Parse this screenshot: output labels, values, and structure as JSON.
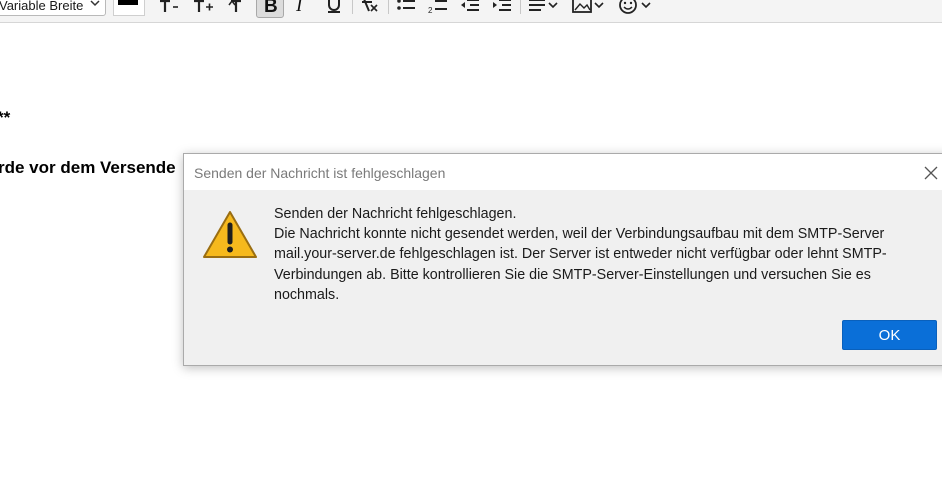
{
  "toolbar": {
    "font_select_value": "Variable Breite",
    "text_color": "#000000",
    "buttons": [
      "decrease-font-size",
      "increase-font-size",
      "bold",
      "italic",
      "underline",
      "clear-formatting",
      "bulleted-list",
      "numbered-list",
      "decrease-indent",
      "increase-indent",
      "align",
      "insert-image",
      "insert-emoji"
    ]
  },
  "message_body": {
    "line1": "**",
    "line2": "rde vor dem Versende"
  },
  "dialog": {
    "title": "Senden der Nachricht ist fehlgeschlagen",
    "icon": "warning-icon",
    "message_lines": [
      "Senden der Nachricht fehlgeschlagen.",
      "Die Nachricht konnte nicht gesendet werden, weil der Verbindungsaufbau mit dem SMTP-Server",
      "mail.your-server.de fehlgeschlagen ist. Der Server ist entweder nicht verfügbar oder lehnt SMTP-",
      "Verbindungen ab. Bitte kontrollieren Sie die SMTP-Server-Einstellungen und versuchen Sie es",
      "nochmals."
    ],
    "ok_label": "OK",
    "accent_color": "#0a6fd8"
  }
}
